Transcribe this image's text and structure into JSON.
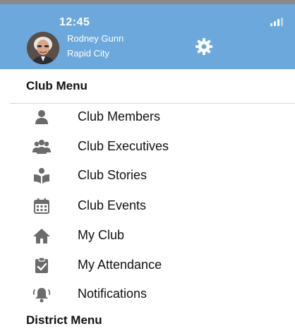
{
  "status_bar": {
    "time": "12:45",
    "signal_icon": "signal-bars-icon"
  },
  "profile": {
    "name": "Rodney Gunn",
    "city": "Rapid City",
    "avatar_icon": "user-avatar",
    "settings_icon": "gear-icon"
  },
  "club_menu": {
    "title": "Club Menu",
    "items": [
      {
        "label": "Club Members",
        "icon": "person-icon"
      },
      {
        "label": "Club Executives",
        "icon": "group-icon"
      },
      {
        "label": "Club Stories",
        "icon": "book-reader-icon"
      },
      {
        "label": "Club Events",
        "icon": "calendar-icon"
      },
      {
        "label": "My Club",
        "icon": "home-icon"
      },
      {
        "label": "My Attendance",
        "icon": "clipboard-check-icon"
      },
      {
        "label": "Notifications",
        "icon": "bell-icon"
      }
    ]
  },
  "district_menu": {
    "title": "District Menu"
  },
  "colors": {
    "header_bg": "#6da8dc",
    "icon_gray": "#6b6b6b",
    "text": "#111111"
  }
}
